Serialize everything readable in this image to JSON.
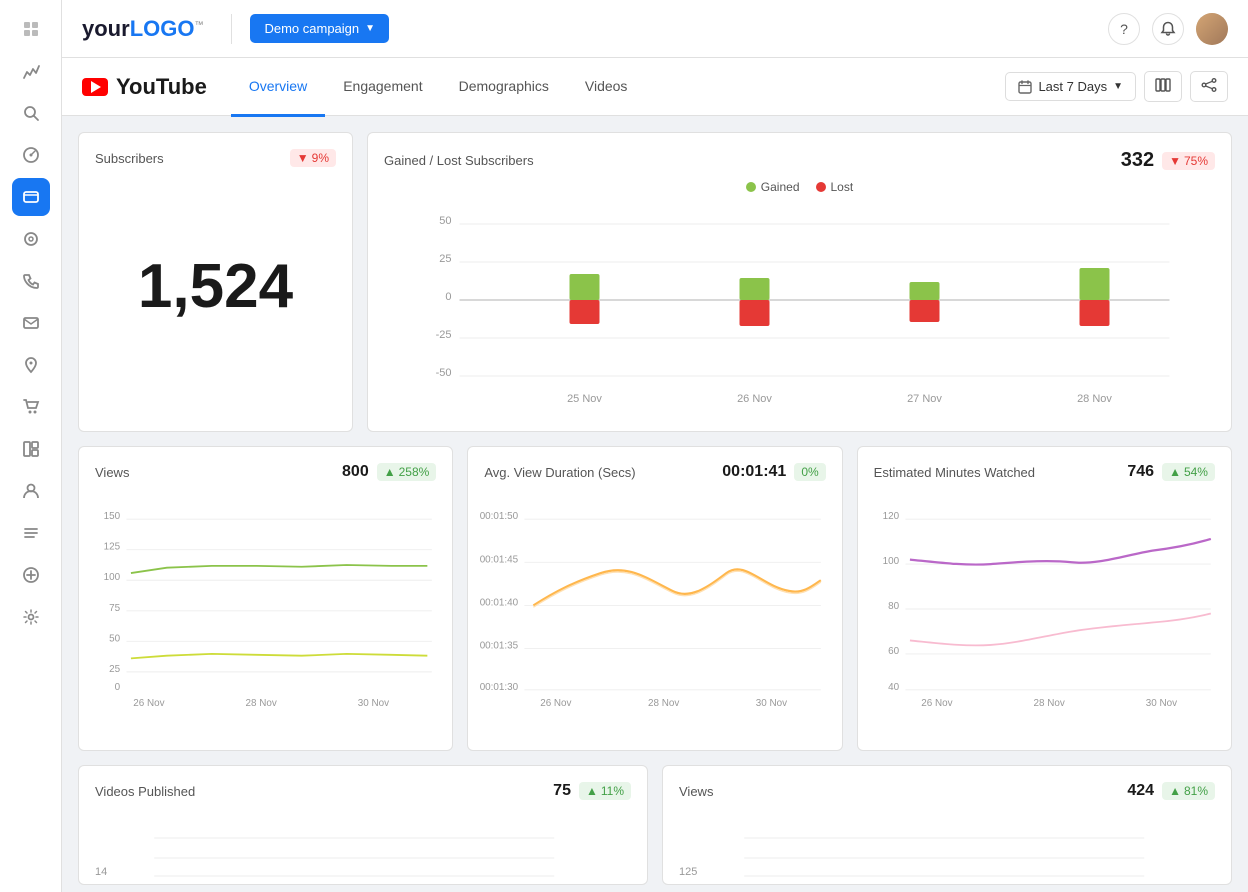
{
  "app": {
    "logo_text": "your LOGO",
    "logo_tm": "™"
  },
  "topbar": {
    "demo_campaign": "Demo campaign",
    "question_icon": "?",
    "bell_icon": "🔔"
  },
  "page": {
    "platform_icon": "yt",
    "platform_name": "YouTube",
    "tabs": [
      {
        "id": "overview",
        "label": "Overview",
        "active": true
      },
      {
        "id": "engagement",
        "label": "Engagement",
        "active": false
      },
      {
        "id": "demographics",
        "label": "Demographics",
        "active": false
      },
      {
        "id": "videos",
        "label": "Videos",
        "active": false
      }
    ],
    "date_range": "Last 7 Days",
    "calendar_icon": "📅"
  },
  "subscribers_card": {
    "title": "Subscribers",
    "change": "9%",
    "change_type": "down",
    "value": "1,524"
  },
  "gained_lost_card": {
    "title": "Gained / Lost Subscribers",
    "value": "332",
    "change": "75%",
    "change_type": "down",
    "legend_gained": "Gained",
    "legend_lost": "Lost",
    "y_labels": [
      "50",
      "25",
      "0",
      "-25",
      "-50"
    ],
    "x_labels": [
      "25 Nov",
      "26 Nov",
      "27 Nov",
      "28 Nov"
    ],
    "bars": [
      {
        "gained": 22,
        "lost": -20
      },
      {
        "gained": 18,
        "lost": -22
      },
      {
        "gained": 15,
        "lost": -18
      },
      {
        "gained": 26,
        "lost": -22
      }
    ]
  },
  "views_card": {
    "title": "Views",
    "value": "800",
    "change": "258%",
    "change_type": "up",
    "y_labels": [
      "150",
      "125",
      "100",
      "75",
      "50",
      "25",
      "0"
    ],
    "x_labels": [
      "26 Nov",
      "28 Nov",
      "30 Nov"
    ]
  },
  "avg_duration_card": {
    "title": "Avg. View Duration (Secs)",
    "value": "00:01:41",
    "change": "0%",
    "change_type": "neutral",
    "y_labels": [
      "00:01:50",
      "00:01:45",
      "00:01:40",
      "00:01:35",
      "00:01:30"
    ],
    "x_labels": [
      "26 Nov",
      "28 Nov",
      "30 Nov"
    ]
  },
  "minutes_card": {
    "title": "Estimated Minutes Watched",
    "value": "746",
    "change": "54%",
    "change_type": "up",
    "y_labels": [
      "120",
      "100",
      "80",
      "60",
      "40"
    ],
    "x_labels": [
      "26 Nov",
      "28 Nov",
      "30 Nov"
    ]
  },
  "videos_published_card": {
    "title": "Videos Published",
    "value": "75",
    "change": "11%",
    "change_type": "up",
    "y_label_top": "14"
  },
  "views_bottom_card": {
    "title": "Views",
    "value": "424",
    "change": "81%",
    "change_type": "up",
    "y_label_top": "125"
  },
  "sidebar": {
    "items": [
      {
        "id": "home",
        "icon": "⊞",
        "active": false
      },
      {
        "id": "analytics",
        "icon": "◈",
        "active": false
      },
      {
        "id": "search",
        "icon": "⌕",
        "active": false
      },
      {
        "id": "reports",
        "icon": "◷",
        "active": false
      },
      {
        "id": "social",
        "icon": "✉",
        "active": true
      },
      {
        "id": "listen",
        "icon": "◎",
        "active": false
      },
      {
        "id": "phone",
        "icon": "☏",
        "active": false
      },
      {
        "id": "mail",
        "icon": "✉",
        "active": false
      },
      {
        "id": "location",
        "icon": "◉",
        "active": false
      },
      {
        "id": "cart",
        "icon": "⊡",
        "active": false
      },
      {
        "id": "grid",
        "icon": "⊞",
        "active": false
      },
      {
        "id": "user",
        "icon": "☺",
        "active": false
      },
      {
        "id": "list",
        "icon": "≡",
        "active": false
      },
      {
        "id": "plugin",
        "icon": "⊕",
        "active": false
      },
      {
        "id": "settings",
        "icon": "⚙",
        "active": false
      }
    ]
  }
}
